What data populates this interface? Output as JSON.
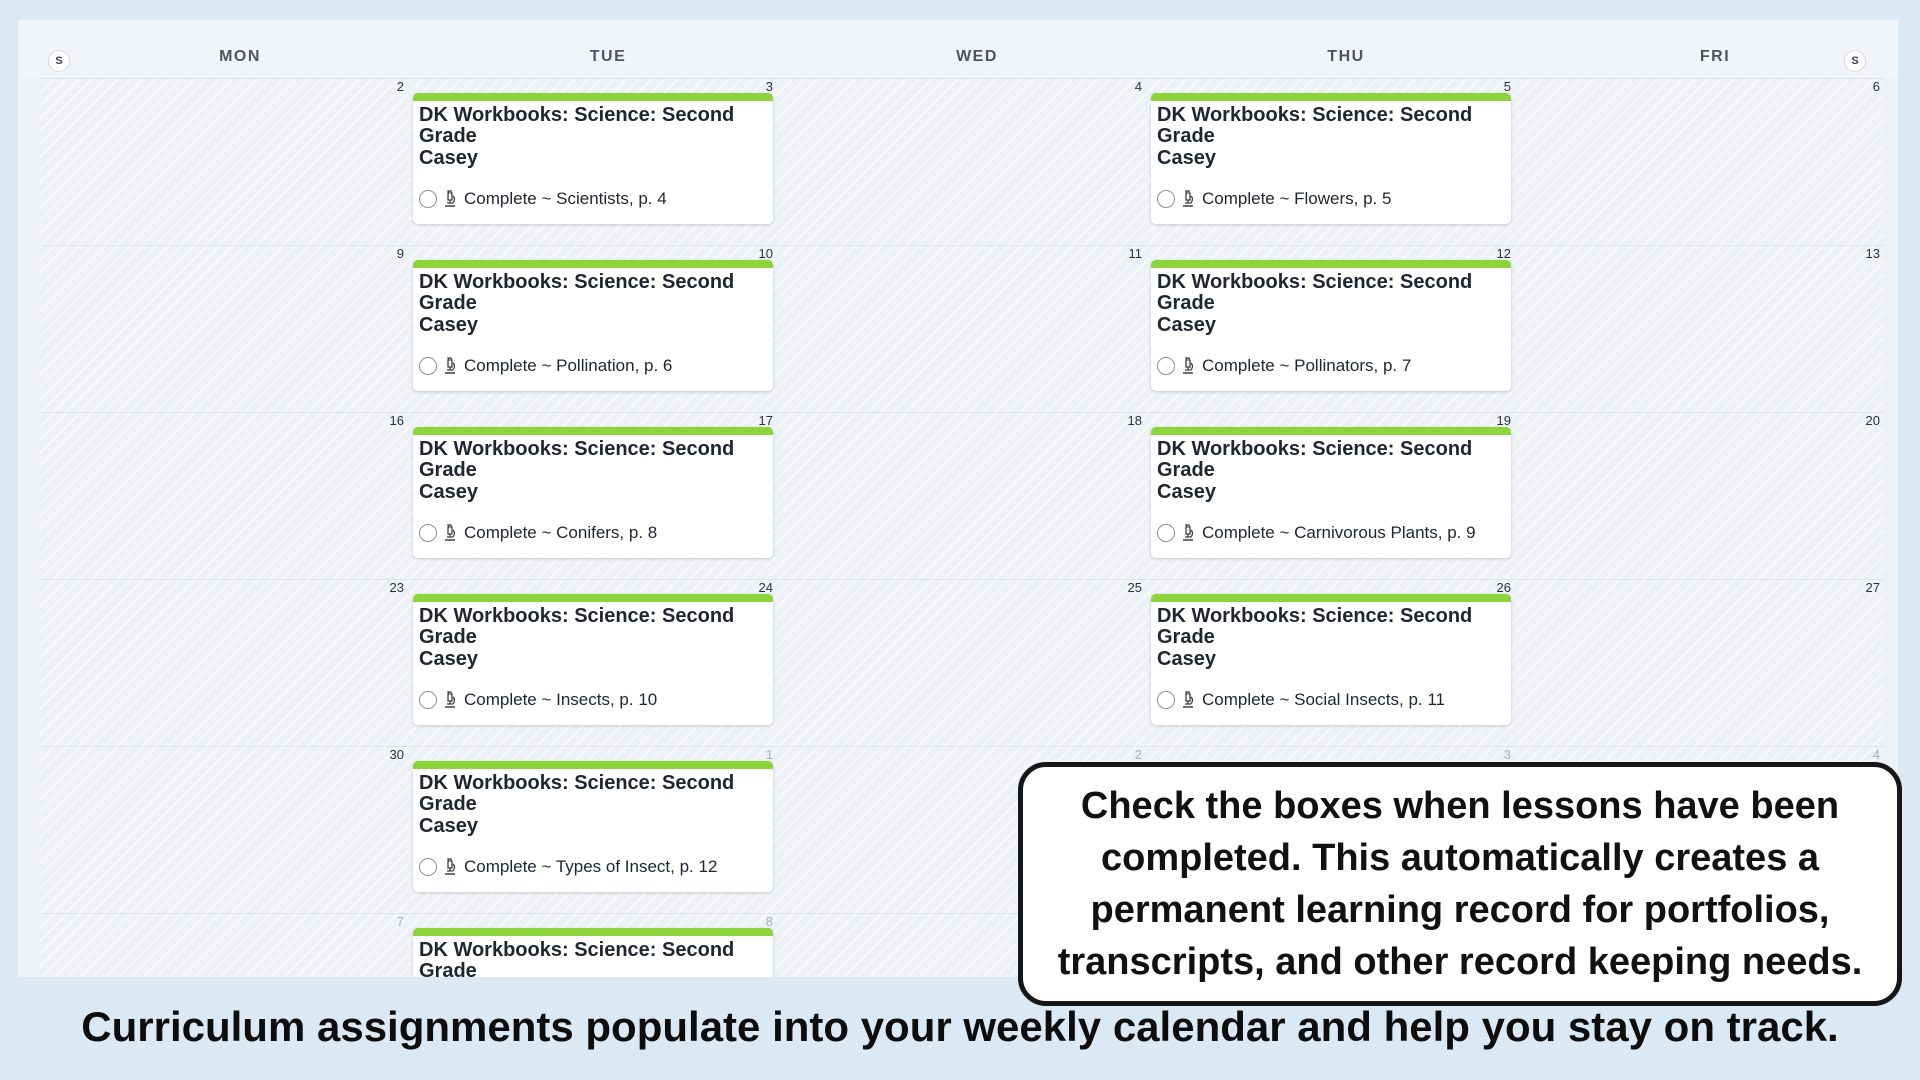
{
  "calendar": {
    "weekend_toggle_left": "S",
    "weekend_toggle_right": "S",
    "days": [
      "MON",
      "TUE",
      "WED",
      "THU",
      "FRI"
    ],
    "weeks": [
      {
        "dates": [
          "2",
          "3",
          "4",
          "5",
          "6"
        ],
        "faded": [
          false,
          false,
          false,
          false,
          false
        ],
        "events": {
          "1": {
            "title": "DK Workbooks: Science: Second Grade",
            "student": "Casey",
            "task": "Complete ~ Scientists, p. 4"
          },
          "3": {
            "title": "DK Workbooks: Science: Second Grade",
            "student": "Casey",
            "task": "Complete ~ Flowers, p. 5"
          }
        }
      },
      {
        "dates": [
          "9",
          "10",
          "11",
          "12",
          "13"
        ],
        "faded": [
          false,
          false,
          false,
          false,
          false
        ],
        "events": {
          "1": {
            "title": "DK Workbooks: Science: Second Grade",
            "student": "Casey",
            "task": "Complete ~ Pollination, p. 6"
          },
          "3": {
            "title": "DK Workbooks: Science: Second Grade",
            "student": "Casey",
            "task": "Complete ~ Pollinators, p. 7"
          }
        }
      },
      {
        "dates": [
          "16",
          "17",
          "18",
          "19",
          "20"
        ],
        "faded": [
          false,
          false,
          false,
          false,
          false
        ],
        "events": {
          "1": {
            "title": "DK Workbooks: Science: Second Grade",
            "student": "Casey",
            "task": "Complete ~ Conifers, p. 8"
          },
          "3": {
            "title": "DK Workbooks: Science: Second Grade",
            "student": "Casey",
            "task": "Complete ~ Carnivorous Plants, p. 9"
          }
        }
      },
      {
        "dates": [
          "23",
          "24",
          "25",
          "26",
          "27"
        ],
        "faded": [
          false,
          false,
          false,
          false,
          false
        ],
        "events": {
          "1": {
            "title": "DK Workbooks: Science: Second Grade",
            "student": "Casey",
            "task": "Complete ~ Insects, p. 10"
          },
          "3": {
            "title": "DK Workbooks: Science: Second Grade",
            "student": "Casey",
            "task": "Complete ~ Social Insects, p. 11"
          }
        }
      },
      {
        "dates": [
          "30",
          "1",
          "2",
          "3",
          "4"
        ],
        "faded": [
          false,
          true,
          true,
          true,
          true
        ],
        "events": {
          "1": {
            "title": "DK Workbooks: Science: Second Grade",
            "student": "Casey",
            "task": "Complete ~ Types of Insect, p. 12"
          }
        }
      },
      {
        "dates": [
          "7",
          "8",
          "",
          "",
          ""
        ],
        "faded": [
          true,
          true,
          true,
          true,
          true
        ],
        "events": {
          "1": {
            "title": "DK Workbooks: Science: Second Grade",
            "student": "",
            "task": ""
          }
        }
      }
    ],
    "event_color": "#8dd43a"
  },
  "callout": {
    "text": "Check the boxes when lessons have been completed. This automatically creates a permanent learning record for portfolios, transcripts, and other record keeping needs."
  },
  "caption": {
    "text": "Curriculum assignments populate into your weekly calendar and help you stay on track."
  },
  "icons": {
    "task_icon": "microscope-icon",
    "checkbox_icon": "circle-checkbox-icon"
  }
}
